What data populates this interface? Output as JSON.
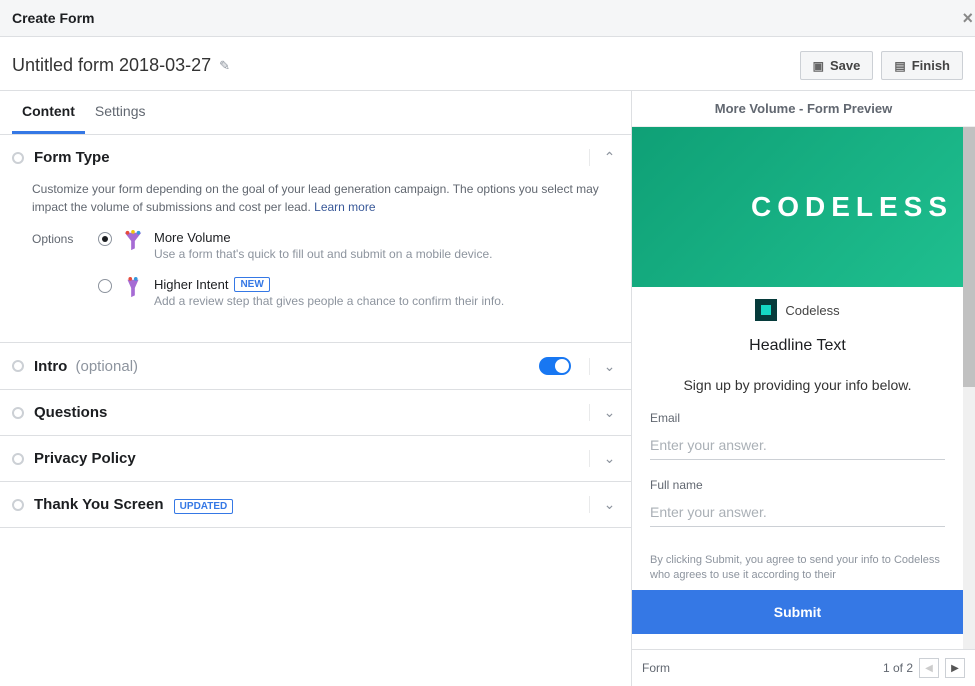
{
  "header": {
    "title": "Create Form"
  },
  "form": {
    "name": "Untitled form 2018-03-27"
  },
  "actions": {
    "save_label": "Save",
    "finish_label": "Finish"
  },
  "tabs": {
    "content": "Content",
    "settings": "Settings"
  },
  "sections": {
    "form_type": {
      "title": "Form Type",
      "description": "Customize your form depending on the goal of your lead generation campaign. The options you select may impact the volume of submissions and cost per lead.",
      "learn_more": "Learn more",
      "options_label": "Options",
      "options": [
        {
          "title": "More Volume",
          "desc": "Use a form that's quick to fill out and submit on a mobile device.",
          "selected": true
        },
        {
          "title": "Higher Intent",
          "desc": "Add a review step that gives people a chance to confirm their info.",
          "badge": "NEW",
          "selected": false
        }
      ]
    },
    "intro": {
      "title": "Intro",
      "optional": "(optional)"
    },
    "questions": {
      "title": "Questions"
    },
    "privacy": {
      "title": "Privacy Policy"
    },
    "thank_you": {
      "title": "Thank You Screen",
      "badge": "UPDATED"
    }
  },
  "preview": {
    "header": "More Volume - Form Preview",
    "hero_brand": "CODELESS",
    "brand_name": "Codeless",
    "headline": "Headline Text",
    "subheadline": "Sign up by providing your info below.",
    "fields": [
      {
        "label": "Email",
        "placeholder": "Enter your answer."
      },
      {
        "label": "Full name",
        "placeholder": "Enter your answer."
      }
    ],
    "disclaimer": "By clicking Submit, you agree to send your info to Codeless who agrees to use it according to their",
    "submit_label": "Submit",
    "footer_label": "Form",
    "page_indicator": "1 of 2"
  }
}
